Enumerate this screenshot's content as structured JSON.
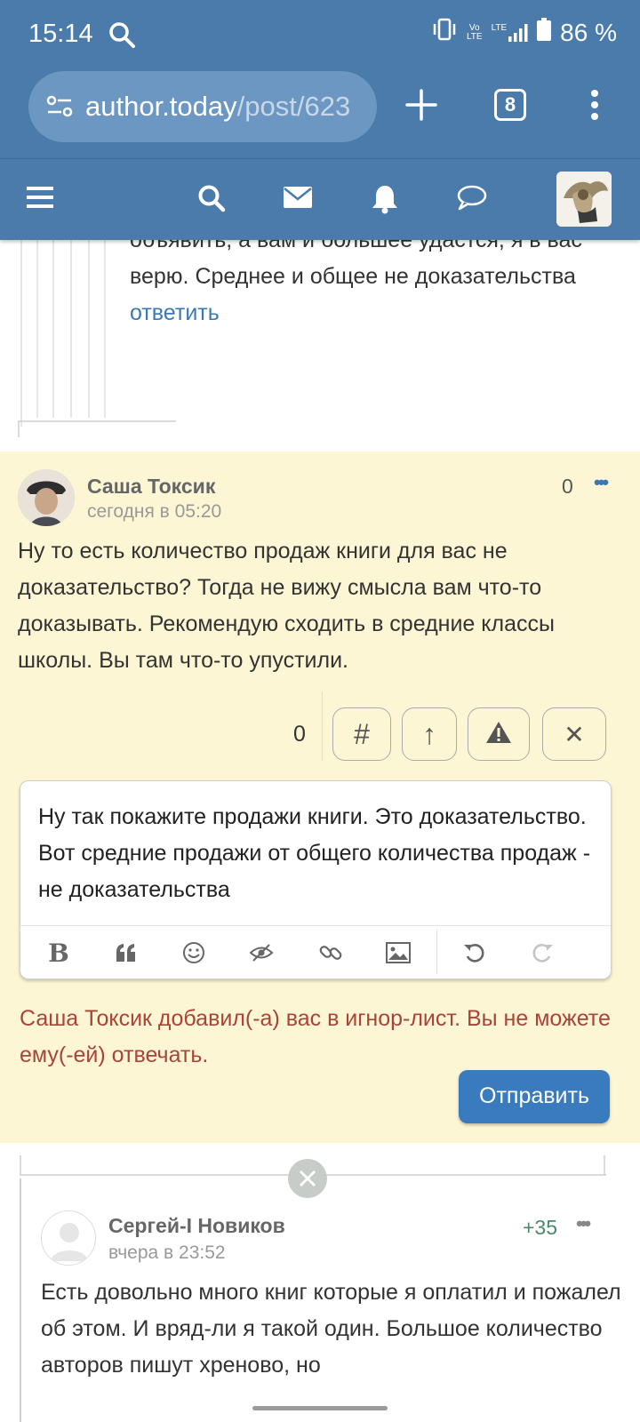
{
  "status_bar": {
    "time": "15:14",
    "signal_vo": "Vo",
    "signal_lte_label": "LTE",
    "lte": "LTE",
    "battery": "86 %"
  },
  "browser": {
    "url_host": "author.today",
    "url_path": "/post/623",
    "tab_count": "8"
  },
  "nav": {
    "icons": [
      "menu-icon",
      "search-icon",
      "mail-icon",
      "bell-icon",
      "chat-icon"
    ]
  },
  "previous_comment": {
    "text": "объявить, а вам и большее удастся, я в вас верю. Среднее и общее не доказательства",
    "reply_label": "ответить"
  },
  "highlighted_comment": {
    "author": "Саша Токсик",
    "date": "сегодня в 05:20",
    "score": "0",
    "more": "•••",
    "text": "Ну то есть количество продаж книги для вас не доказательство? Тогда не вижу смысла вам что-то доказывать. Рекомендую сходить в средние классы школы. Вы там что-то упустили.",
    "action_count": "0",
    "actions": {
      "hash": "#",
      "up": "↑",
      "report": "!",
      "close": "✕"
    }
  },
  "reply_editor": {
    "text": "Ну так покажите продажи книги. Это доказательство. Вот средние продажи от общего количества продаж - не доказательства"
  },
  "ignore_message": "Саша Токсик добавил(-а) вас в игнор-лист. Вы не можете ему(-ей) отвечать.",
  "send_button": "Отправить",
  "next_comment": {
    "author": "Сергей-I Новиков",
    "date": "вчера в 23:52",
    "score": "+35",
    "more": "•••",
    "text": "Есть довольно много книг которые я оплатил и пожалел об этом. И вряд-ли я такой один. Большое количество авторов пишут хреново, но"
  }
}
